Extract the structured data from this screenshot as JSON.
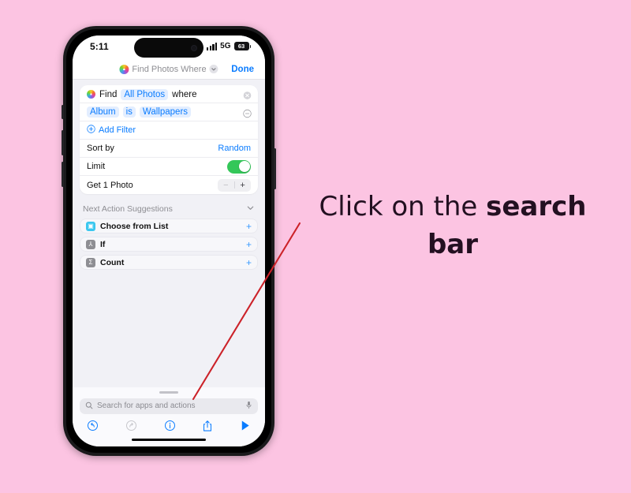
{
  "annotation": {
    "text_prefix": "Click on the ",
    "text_emphasis": "search bar",
    "pointer_color": "#cc2229"
  },
  "background_color": "#fcc4e2",
  "phone": {
    "status_bar": {
      "time": "5:11",
      "network": "5G",
      "battery_level": "63",
      "signal_icon": "signal-bars-icon",
      "battery_icon": "battery-icon"
    },
    "nav_bar": {
      "app_icon": "photos-app-icon",
      "title": "Find Photos Where",
      "chevron_icon": "chevron-down-icon",
      "done_label": "Done"
    },
    "find_action": {
      "app_icon": "photos-app-icon",
      "word_find": "Find",
      "token_source": "All Photos",
      "word_where": "where",
      "clear_icon": "clear-circle-icon",
      "filter_field": "Album",
      "filter_operator": "is",
      "filter_value": "Wallpapers",
      "remove_icon": "minus-circle-icon",
      "add_filter_icon": "plus-circle-icon",
      "add_filter_label": "Add Filter",
      "sort_by_label": "Sort by",
      "sort_by_value": "Random",
      "limit_label": "Limit",
      "limit_enabled": true,
      "get_photo_label": "Get 1 Photo",
      "stepper_minus": "−",
      "stepper_plus": "+"
    },
    "suggestions": {
      "title": "Next Action Suggestions",
      "collapse_icon": "chevron-down-icon",
      "items": [
        {
          "label": "Choose from List",
          "icon": "choose-from-list-icon",
          "icon_glyph": "▣",
          "icon_color": "cyan",
          "add_glyph": "+"
        },
        {
          "label": "If",
          "icon": "if-condition-icon",
          "icon_glyph": "⅄",
          "icon_color": "gray",
          "add_glyph": "+"
        },
        {
          "label": "Count",
          "icon": "count-icon",
          "icon_glyph": "Σ",
          "icon_color": "gray",
          "add_glyph": "+"
        }
      ]
    },
    "dock": {
      "search_placeholder": "Search for apps and actions",
      "search_icon": "search-icon",
      "mic_icon": "microphone-icon",
      "toolbar": [
        {
          "name": "undo-button",
          "state": "enabled"
        },
        {
          "name": "redo-button",
          "state": "disabled"
        },
        {
          "name": "info-button",
          "state": "enabled"
        },
        {
          "name": "share-button",
          "state": "enabled"
        },
        {
          "name": "run-button",
          "state": "enabled"
        }
      ]
    }
  }
}
